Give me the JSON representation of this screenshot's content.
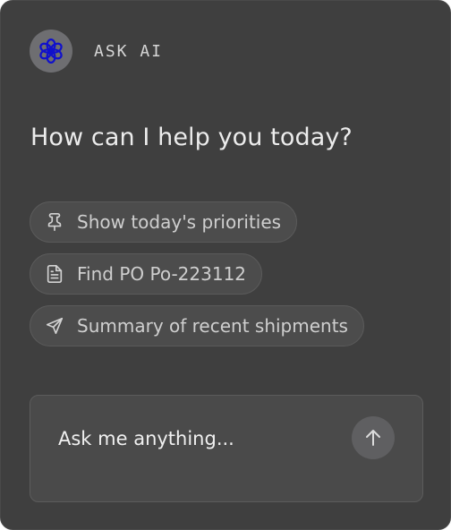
{
  "header": {
    "title": "ASK AI",
    "avatar_icon": "sparkle-flower-icon"
  },
  "heading": "How can I help you today?",
  "suggestions": [
    {
      "icon": "pin-icon",
      "label": "Show today's priorities"
    },
    {
      "icon": "document-icon",
      "label": "Find PO Po-223112"
    },
    {
      "icon": "send-icon",
      "label": "Summary of recent shipments"
    }
  ],
  "input": {
    "placeholder": "Ask me anything...",
    "value": ""
  },
  "send_button": {
    "icon": "arrow-up-icon"
  },
  "colors": {
    "panel_bg": "#3f3f3f",
    "chip_bg": "#4c4c4c",
    "avatar_bg": "#6e6e71",
    "avatar_icon": "#1010cc",
    "text_primary": "#ececec",
    "text_secondary": "#cfcfcf"
  }
}
